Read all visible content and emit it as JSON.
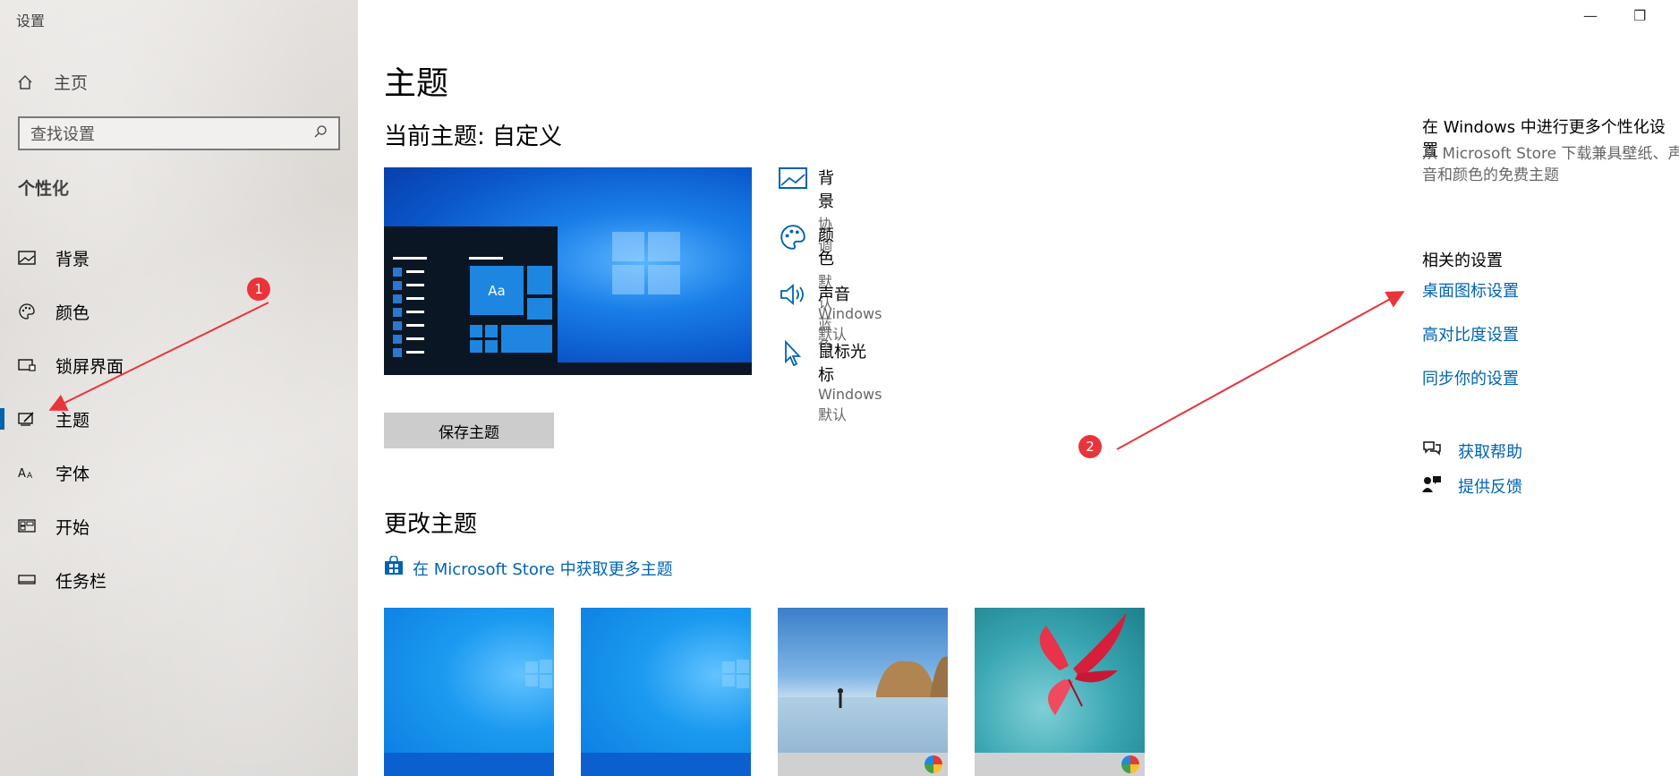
{
  "window": {
    "title": "设置",
    "minimize_glyph": "—",
    "restore_glyph": "❐"
  },
  "sidebar": {
    "home_label": "主页",
    "search_placeholder": "查找设置",
    "section_title": "个性化",
    "items": [
      {
        "label": "背景",
        "icon": "image-icon"
      },
      {
        "label": "颜色",
        "icon": "palette-icon"
      },
      {
        "label": "锁屏界面",
        "icon": "lock-screen-icon"
      },
      {
        "label": "主题",
        "icon": "theme-icon",
        "active": true
      },
      {
        "label": "字体",
        "icon": "font-icon"
      },
      {
        "label": "开始",
        "icon": "start-icon"
      },
      {
        "label": "任务栏",
        "icon": "taskbar-icon"
      }
    ]
  },
  "main": {
    "title": "主题",
    "current_theme": "当前主题: 自定义",
    "preview_aa": "Aa",
    "properties": [
      {
        "title": "背景",
        "sub": "协调",
        "icon": "image-icon"
      },
      {
        "title": "颜色",
        "sub": "默认蓝色",
        "icon": "palette-icon"
      },
      {
        "title": "声音",
        "sub": "Windows 默认",
        "icon": "speaker-icon"
      },
      {
        "title": "鼠标光标",
        "sub": "Windows 默认",
        "icon": "cursor-icon"
      }
    ],
    "save_button": "保存主题",
    "change_title": "更改主题",
    "store_link": "在 Microsoft Store 中获取更多主题"
  },
  "right": {
    "personalize_title": "在 Windows 中进行更多个性化设置",
    "personalize_desc": "从 Microsoft Store 下载兼具壁纸、声音和颜色的免费主题",
    "related_title": "相关的设置",
    "links": [
      "桌面图标设置",
      "高对比度设置",
      "同步你的设置"
    ],
    "help": "获取帮助",
    "feedback": "提供反馈"
  },
  "annotations": {
    "marker1": "1",
    "marker2": "2",
    "color": "#e8343a"
  },
  "colors": {
    "accent": "#0063b1"
  }
}
